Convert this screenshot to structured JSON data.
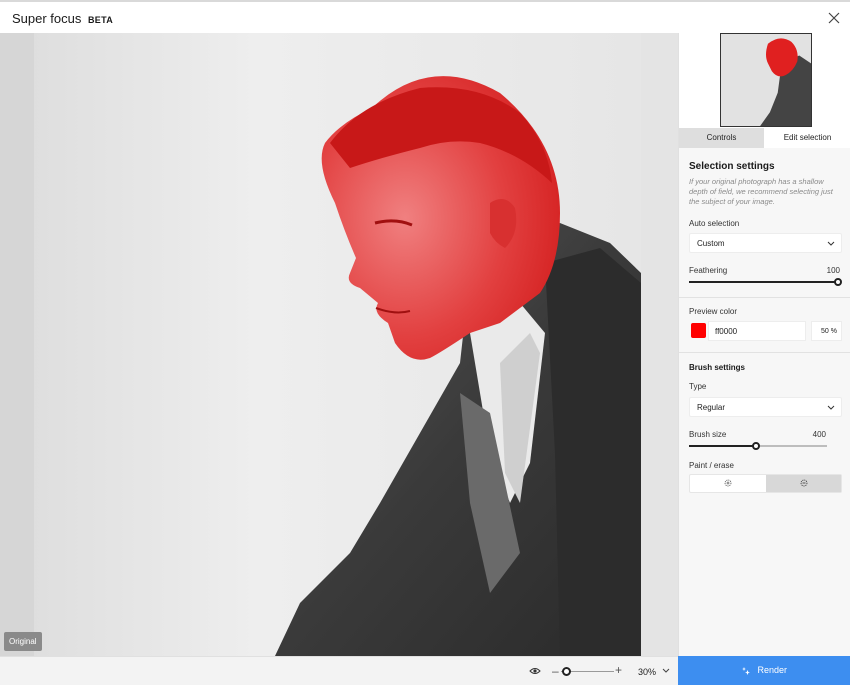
{
  "window": {
    "title": "Super focus",
    "badge": "BETA"
  },
  "canvas": {
    "original_label": "Original"
  },
  "zoom": {
    "minus": "–",
    "plus": "+",
    "value": "30%",
    "level": 0.07
  },
  "tabs": [
    {
      "label": "Controls"
    },
    {
      "label": "Edit selection",
      "active": true
    }
  ],
  "selection_settings": {
    "title": "Selection settings",
    "description": "If your original photograph has a shallow depth of field, we recommend selecting just the subject of your image.",
    "auto_selection": {
      "label": "Auto selection",
      "value": "Custom"
    },
    "feathering": {
      "label": "Feathering",
      "value": "100",
      "level": 1.0
    },
    "preview_color": {
      "label": "Preview color",
      "hex": "ff0000",
      "opacity": "50",
      "opacity_unit": "%",
      "swatch": "#ff0000"
    }
  },
  "brush_settings": {
    "title": "Brush settings",
    "type": {
      "label": "Type",
      "value": "Regular"
    },
    "brush_size": {
      "label": "Brush size",
      "value": "400",
      "level": 0.46
    },
    "paint_erase": {
      "label": "Paint / erase",
      "selected": "erase"
    }
  },
  "render": {
    "label": "Render"
  },
  "colors": {
    "accent": "#3d8ef0",
    "mask": "#e0201f"
  },
  "icons": {
    "close": "close-icon",
    "eye": "eye-icon",
    "render": "sparkle-icon",
    "paint": "brush-paint-icon",
    "erase": "brush-erase-icon"
  }
}
